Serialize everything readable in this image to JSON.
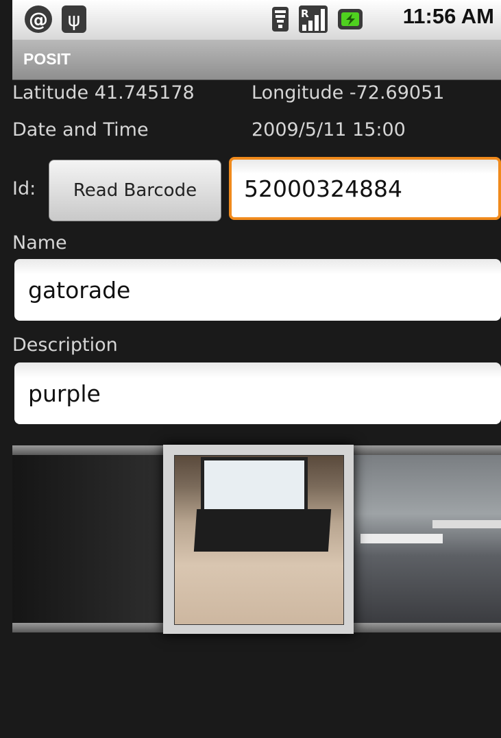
{
  "status_bar": {
    "time": "11:56 AM",
    "icons": [
      "at-sign-icon",
      "usb-icon",
      "wifi-icon",
      "roaming-signal-icon",
      "battery-charging-icon"
    ]
  },
  "app": {
    "title": "POSIT"
  },
  "location": {
    "latitude_label": "Latitude 41.745178",
    "longitude_label": "Longitude  -72.69051"
  },
  "datetime": {
    "label": "Date and Time",
    "value": "2009/5/11 15:00"
  },
  "form": {
    "id_label": "Id:",
    "read_barcode_label": "Read Barcode",
    "id_value": "52000324884",
    "name_label": "Name",
    "name_value": "gatorade",
    "description_label": "Description",
    "description_value": "purple"
  },
  "colors": {
    "focus_border": "#f08a1c",
    "background": "#1a1a1a"
  }
}
